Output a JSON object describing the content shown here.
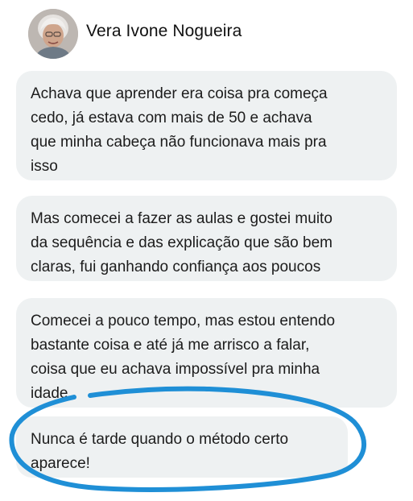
{
  "contact": {
    "name": "Vera Ivone Nogueira",
    "avatar_icon": "user-avatar-photo"
  },
  "messages": [
    {
      "lines": [
        "Achava que aprender era coisa pra começa",
        "cedo, já estava com mais de 50 e achava",
        "que minha cabeça não funcionava mais pra",
        "isso"
      ]
    },
    {
      "lines": [
        "Mas comecei a fazer as aulas e gostei muito",
        "da sequência e das explicação que são bem",
        "claras, fui ganhando confiança aos poucos"
      ]
    },
    {
      "lines": [
        "Comecei a pouco tempo, mas estou entendo",
        "bastante coisa e até já me arrisco a falar,",
        "coisa que eu achava impossível pra minha",
        "idade"
      ]
    },
    {
      "lines": [
        "Nunca é tarde quando o método certo",
        "aparece!"
      ],
      "highlighted": true
    }
  ],
  "colors": {
    "bubble_background": "#eef1f2",
    "highlight_stroke": "#1f8fd6",
    "text": "#1c1c1c"
  }
}
